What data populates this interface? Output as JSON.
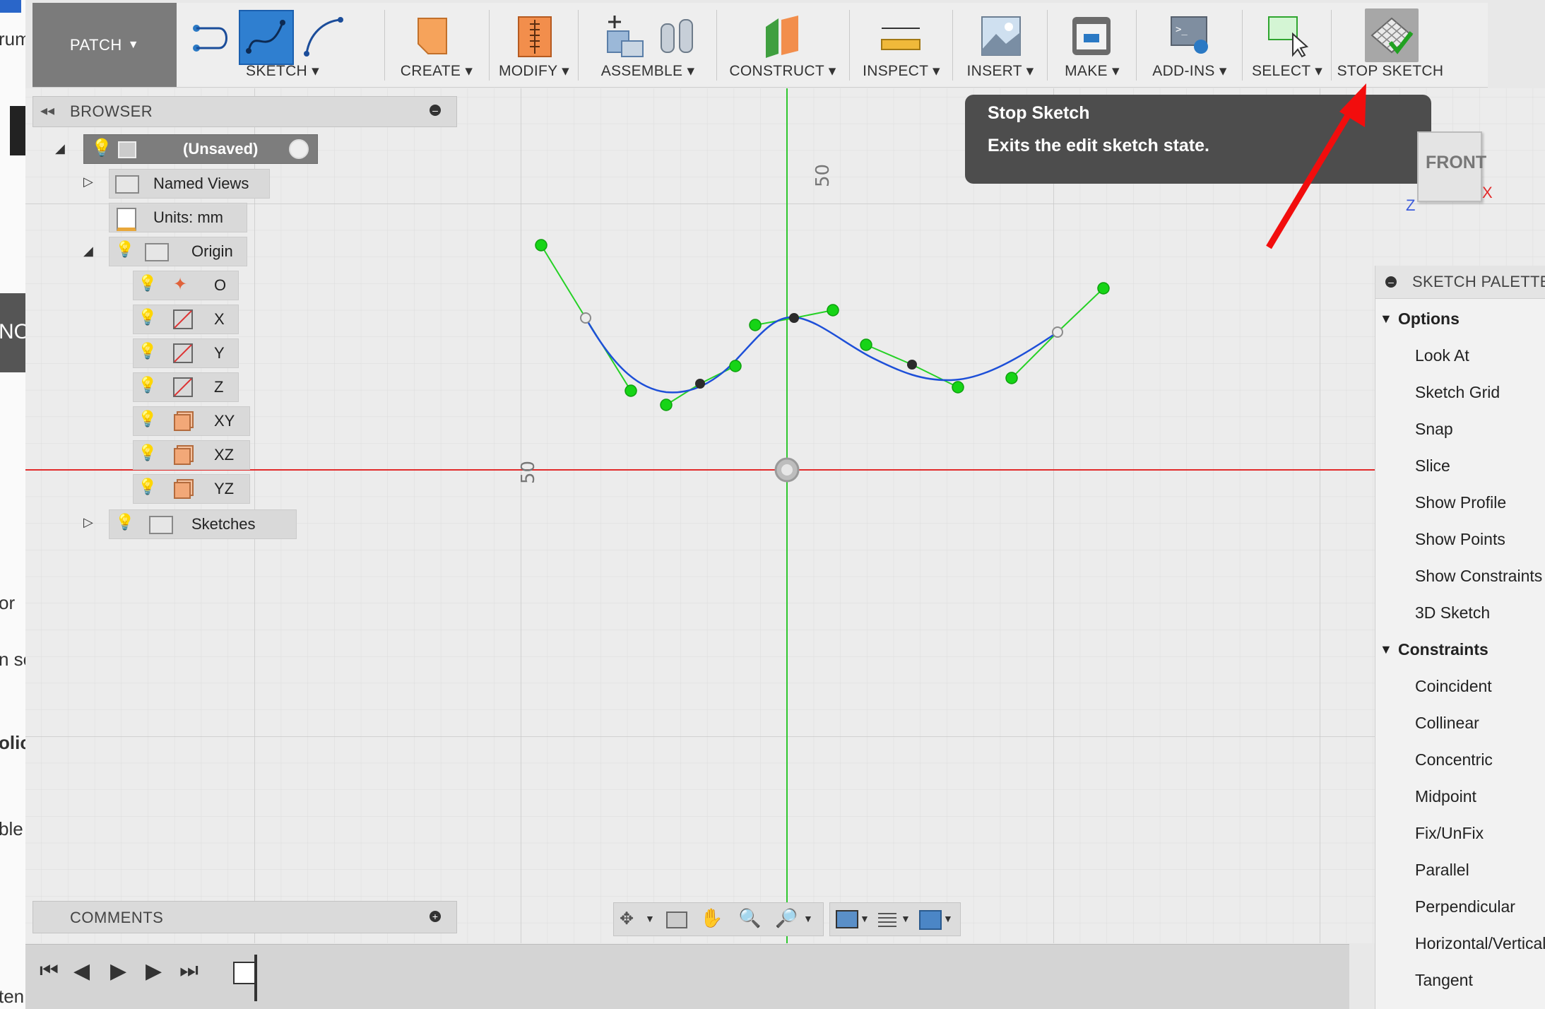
{
  "behind_window": {
    "fragments": [
      "rum",
      "NO",
      "or",
      "n sc",
      "olic",
      "ble",
      "ten"
    ]
  },
  "toolbar": {
    "workspace": "PATCH",
    "groups": [
      {
        "label": "SKETCH",
        "icon": "sketch-icon"
      },
      {
        "label": "CREATE",
        "icon": "create-icon"
      },
      {
        "label": "MODIFY",
        "icon": "modify-icon"
      },
      {
        "label": "ASSEMBLE",
        "icon": "assemble-icon"
      },
      {
        "label": "CONSTRUCT",
        "icon": "construct-icon"
      },
      {
        "label": "INSPECT",
        "icon": "inspect-icon"
      },
      {
        "label": "INSERT",
        "icon": "insert-icon"
      },
      {
        "label": "MAKE",
        "icon": "make-icon"
      },
      {
        "label": "ADD-INS",
        "icon": "add-ins-icon"
      },
      {
        "label": "SELECT",
        "icon": "select-icon"
      },
      {
        "label": "STOP SKETCH",
        "icon": "stop-sketch-icon"
      }
    ]
  },
  "tooltip": {
    "title": "Stop Sketch",
    "description": "Exits the edit sketch state."
  },
  "browser": {
    "title": "BROWSER",
    "root": "(Unsaved)",
    "named_views": "Named Views",
    "units": "Units: mm",
    "origin": "Origin",
    "origin_items": [
      "O",
      "X",
      "Y",
      "Z",
      "XY",
      "XZ",
      "YZ"
    ],
    "sketches": "Sketches"
  },
  "canvas": {
    "axis_label_top": "50",
    "axis_label_left": "50"
  },
  "viewcube": {
    "face": "FRONT",
    "x_axis": "X",
    "z_axis": "Z"
  },
  "palette": {
    "title": "SKETCH PALETTE",
    "options_label": "Options",
    "options": [
      "Look At",
      "Sketch Grid",
      "Snap",
      "Slice",
      "Show Profile",
      "Show Points",
      "Show Constraints",
      "3D Sketch"
    ],
    "constraints_label": "Constraints",
    "constraints": [
      "Coincident",
      "Collinear",
      "Concentric",
      "Midpoint",
      "Fix/UnFix",
      "Parallel",
      "Perpendicular",
      "Horizontal/Vertical",
      "Tangent"
    ]
  },
  "comments": {
    "title": "COMMENTS"
  },
  "colors": {
    "accent_blue": "#2a79c4",
    "spline_blue": "#1d4fd8",
    "handle_green": "#16d416",
    "axis_red": "#e22b2b",
    "axis_green": "#2fc72f",
    "arrow_red": "#f20d0d"
  }
}
